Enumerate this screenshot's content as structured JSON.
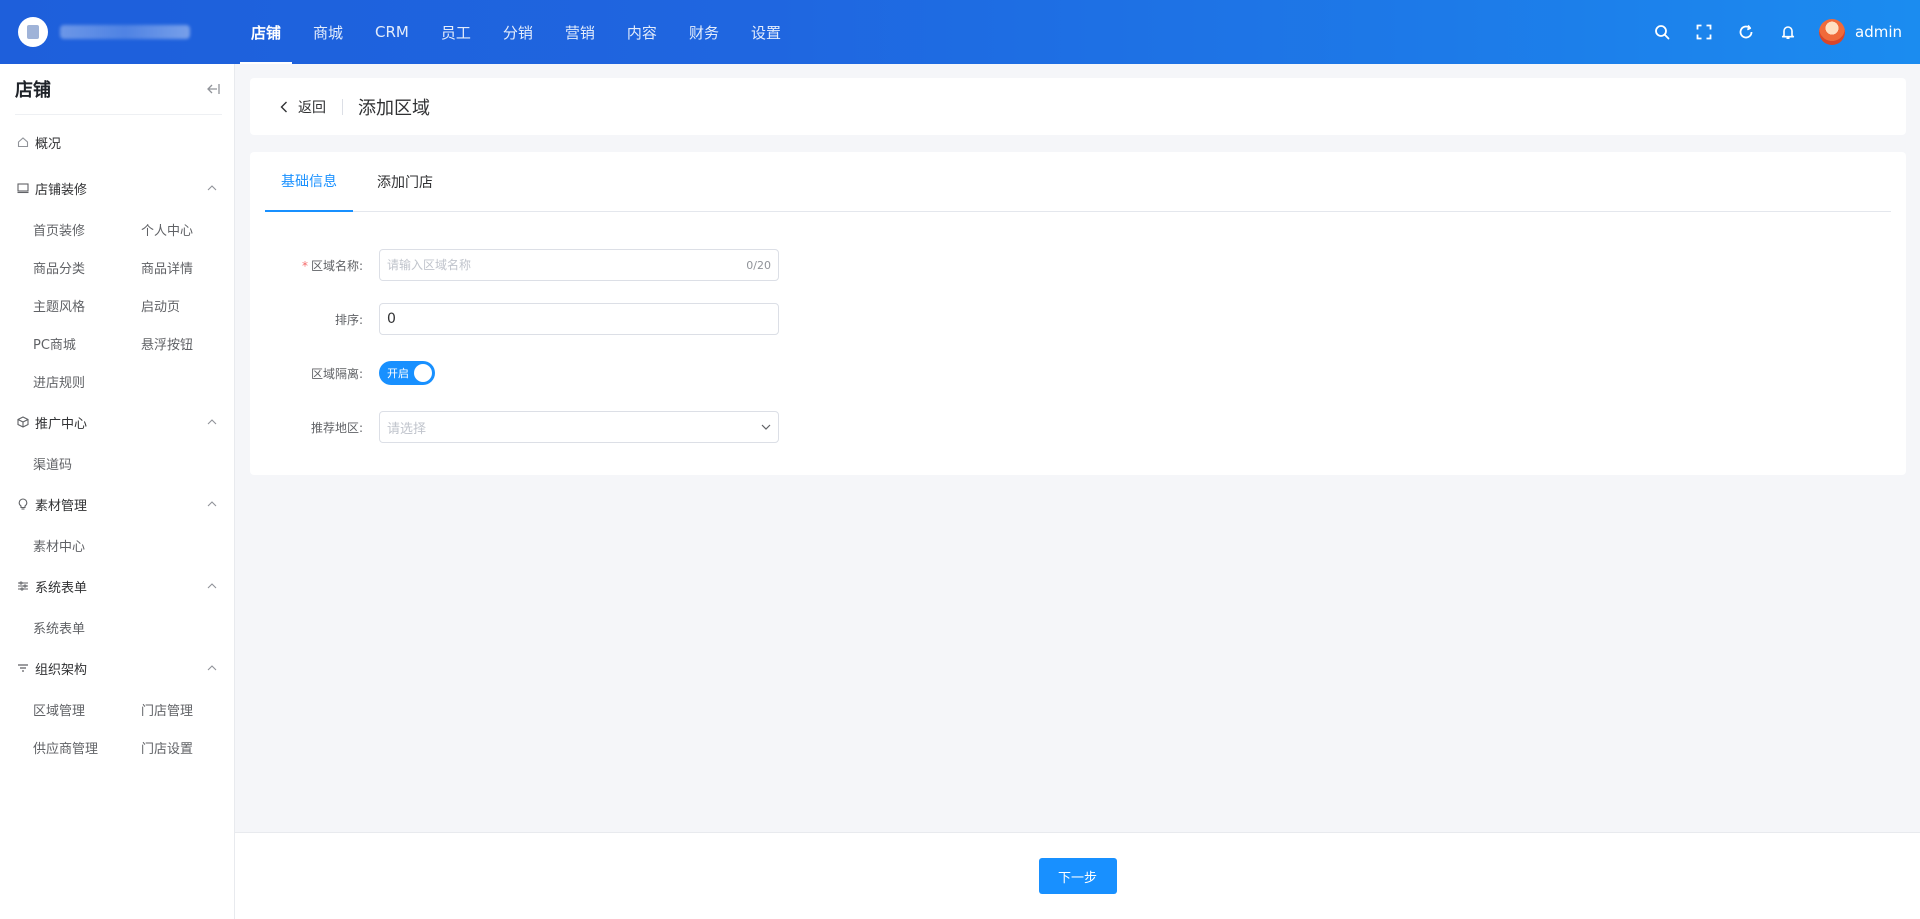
{
  "topbar": {
    "nav": [
      {
        "label": "店铺",
        "active": true
      },
      {
        "label": "商城",
        "active": false
      },
      {
        "label": "CRM",
        "active": false
      },
      {
        "label": "员工",
        "active": false
      },
      {
        "label": "分销",
        "active": false
      },
      {
        "label": "营销",
        "active": false
      },
      {
        "label": "内容",
        "active": false
      },
      {
        "label": "财务",
        "active": false
      },
      {
        "label": "设置",
        "active": false
      }
    ],
    "icons": [
      "search-icon",
      "fullscreen-icon",
      "refresh-icon",
      "bell-icon"
    ],
    "user": "admin"
  },
  "sidebar": {
    "title": "店铺",
    "overview": "概况",
    "groups": [
      {
        "title": "店铺装修",
        "icon": "monitor-icon",
        "items": [
          "首页装修",
          "个人中心",
          "商品分类",
          "商品详情",
          "主题风格",
          "启动页",
          "PC商城",
          "悬浮按钮",
          "进店规则"
        ]
      },
      {
        "title": "推广中心",
        "icon": "cube-icon",
        "items": [
          "渠道码"
        ]
      },
      {
        "title": "素材管理",
        "icon": "bulb-icon",
        "items": [
          "素材中心"
        ]
      },
      {
        "title": "系统表单",
        "icon": "sliders-icon",
        "items": [
          "系统表单"
        ]
      },
      {
        "title": "组织架构",
        "icon": "filter-icon",
        "items": [
          "区域管理",
          "门店管理",
          "供应商管理",
          "门店设置"
        ]
      }
    ]
  },
  "header": {
    "back": "返回",
    "title": "添加区域"
  },
  "tabs": [
    "基础信息",
    "添加门店"
  ],
  "form": {
    "name_label": "区域名称:",
    "name_placeholder": "请输入区域名称",
    "name_counter": "0/20",
    "sort_label": "排序:",
    "sort_value": "0",
    "isolate_label": "区域隔离:",
    "isolate_switch": "开启",
    "region_label": "推荐地区:",
    "region_placeholder": "请选择"
  },
  "footer": {
    "next": "下一步"
  },
  "colors": {
    "primary": "#1890ff",
    "topbar_start": "#1e5fdb",
    "topbar_end": "#1b8cf0"
  }
}
